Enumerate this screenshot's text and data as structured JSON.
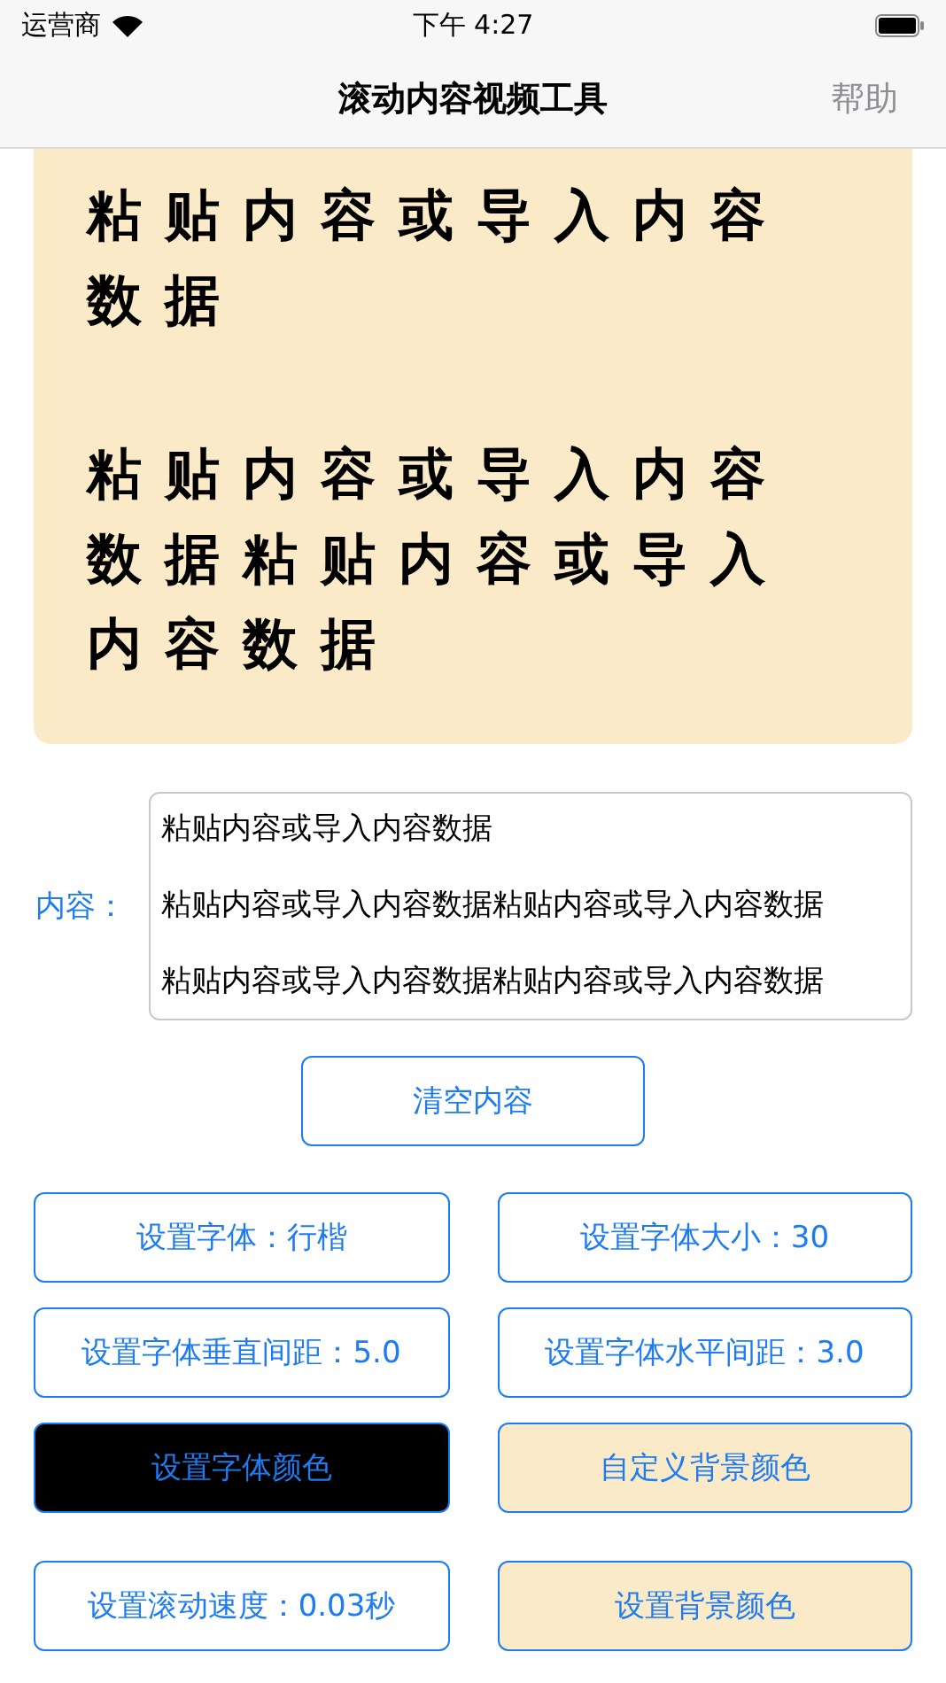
{
  "status_bar": {
    "carrier": "运营商",
    "time": "下午 4:27"
  },
  "nav": {
    "title": "滚动内容视频工具",
    "help": "帮助"
  },
  "preview": {
    "paragraphs": [
      "粘贴内容或导入内容数据",
      "粘贴内容或导入内容数据粘贴内容或导入内容数据"
    ]
  },
  "content": {
    "label": "内容：",
    "lines": [
      "粘贴内容或导入内容数据",
      "粘贴内容或导入内容数据粘贴内容或导入内容数据",
      "粘贴内容或导入内容数据粘贴内容或导入内容数据"
    ]
  },
  "clear_button": "清空内容",
  "buttons": [
    {
      "label": "设置字体：行楷",
      "kind": "plain"
    },
    {
      "label": "设置字体大小：30",
      "kind": "plain"
    },
    {
      "label": "设置字体垂直间距：5.0",
      "kind": "plain"
    },
    {
      "label": "设置字体水平间距：3.0",
      "kind": "plain"
    },
    {
      "label": "设置字体颜色",
      "kind": "dark"
    },
    {
      "label": "自定义背景颜色",
      "kind": "beige"
    },
    {
      "label": "设置滚动速度：0.03秒",
      "kind": "plain"
    },
    {
      "label": "设置背景颜色",
      "kind": "beige"
    }
  ]
}
